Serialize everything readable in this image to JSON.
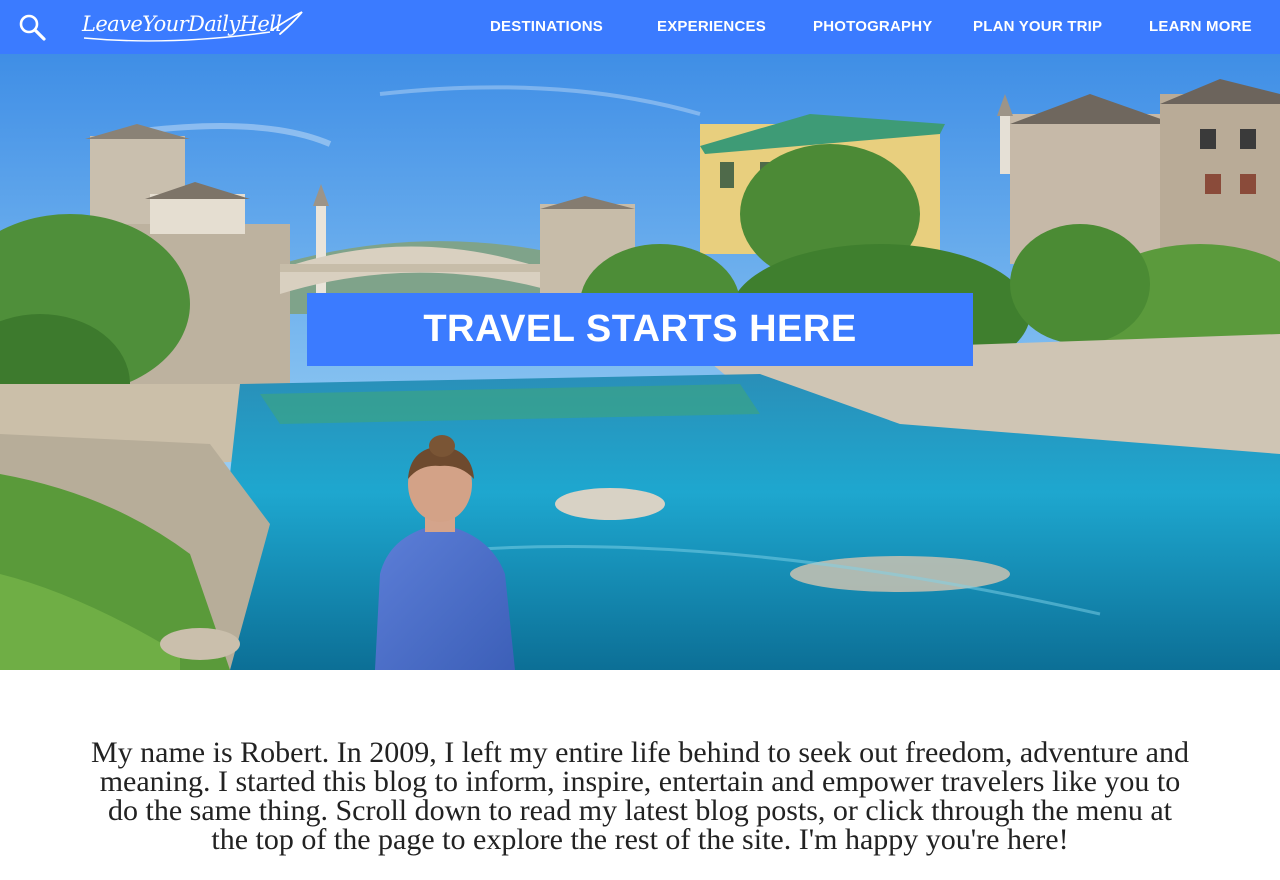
{
  "header": {
    "search_icon": "search-icon",
    "logo_text": "LeaveYourDailyHell",
    "nav": [
      {
        "label": "DESTINATIONS"
      },
      {
        "label": "EXPERIENCES"
      },
      {
        "label": "PHOTOGRAPHY"
      },
      {
        "label": "PLAN YOUR TRIP"
      },
      {
        "label": "LEARN MORE"
      }
    ]
  },
  "hero": {
    "banner": "TRAVEL STARTS HERE"
  },
  "intro": {
    "text": "My name is Robert. In 2009, I left my entire life behind to seek out freedom, adventure and meaning. I started this blog to inform, inspire, entertain and empower travelers like you to do the same thing. Scroll down to read my latest blog posts, or click through the menu at the top of the page to explore the rest of the site. I'm happy you're here!"
  },
  "colors": {
    "brand_blue": "#3b7bff",
    "text": "#222222"
  }
}
